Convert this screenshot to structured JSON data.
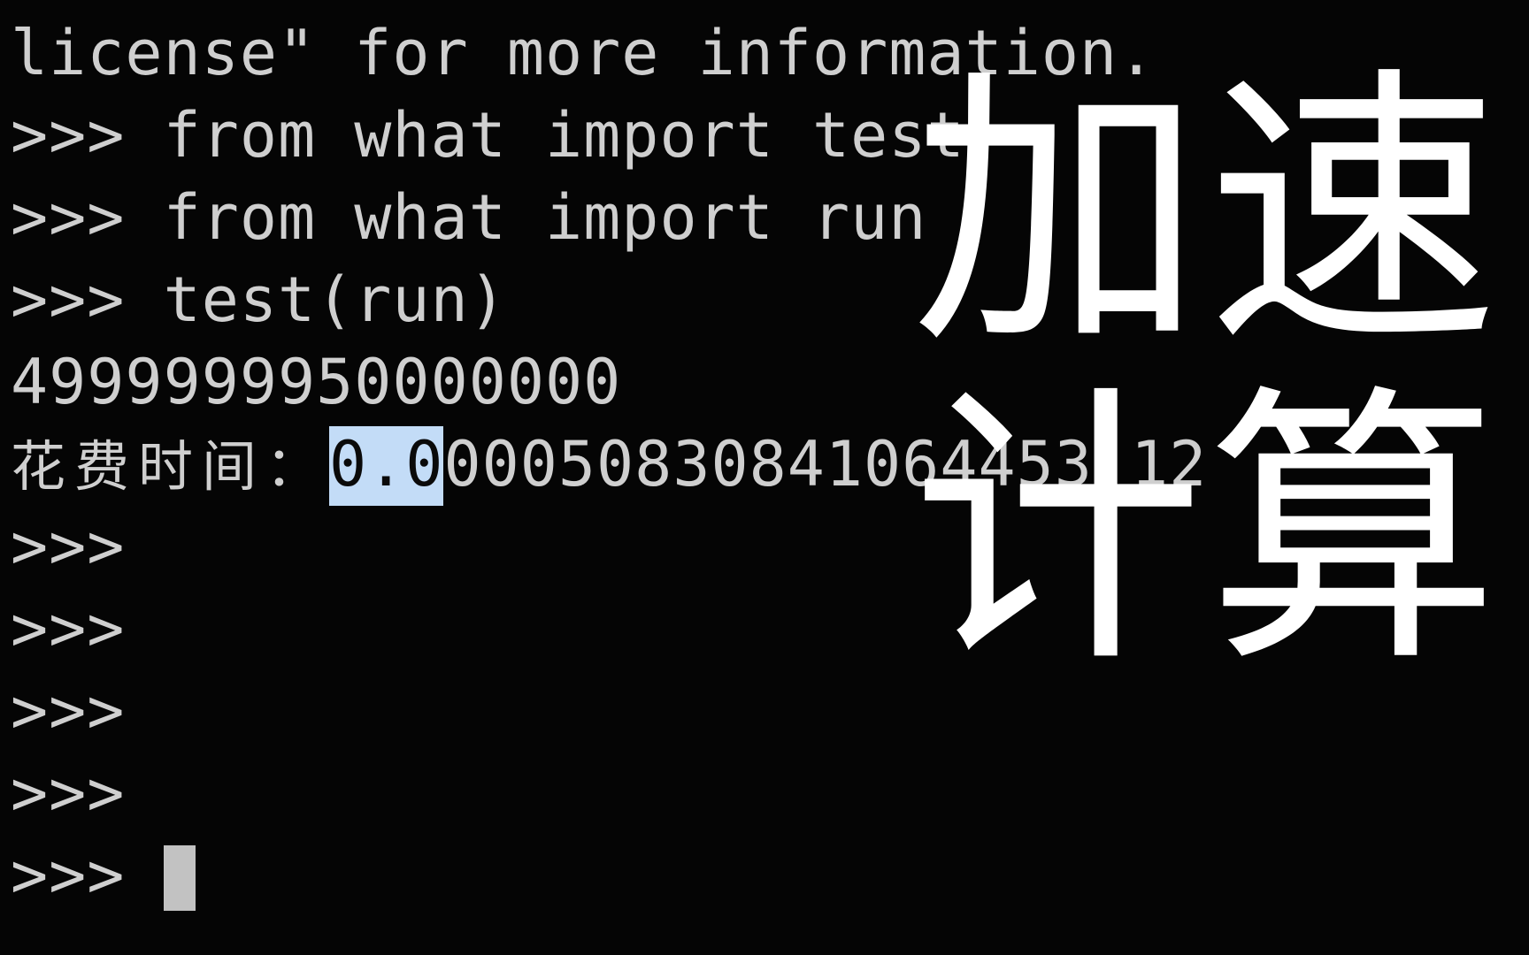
{
  "window": {
    "background_color": "#050505",
    "text_color": "#cfcfcf",
    "selection_background": "#c3dcf7",
    "selection_text_color": "#0a0a0a",
    "overlay_text_color": "#ffffff",
    "cursor_color": "#c2c2c2"
  },
  "terminal": {
    "lines": [
      {
        "text": "license\" for more information."
      },
      {
        "text": ">>> from what import test"
      },
      {
        "text": ">>> from what import run"
      },
      {
        "text": ">>> test(run)"
      },
      {
        "text": "4999999950000000"
      }
    ],
    "timing": {
      "label": "花费时间：",
      "selected_value": "0.0",
      "rest_value": "00050830841064453 12",
      "full_value": "0.0005083084106445312"
    },
    "prompts": [
      {
        "text": ">>>"
      },
      {
        "text": ">>>"
      },
      {
        "text": ">>>"
      },
      {
        "text": ">>>"
      }
    ],
    "active_prompt": ">>>",
    "cursor": "block-cursor"
  },
  "overlay": {
    "line1": "加速",
    "line2": "计算"
  }
}
